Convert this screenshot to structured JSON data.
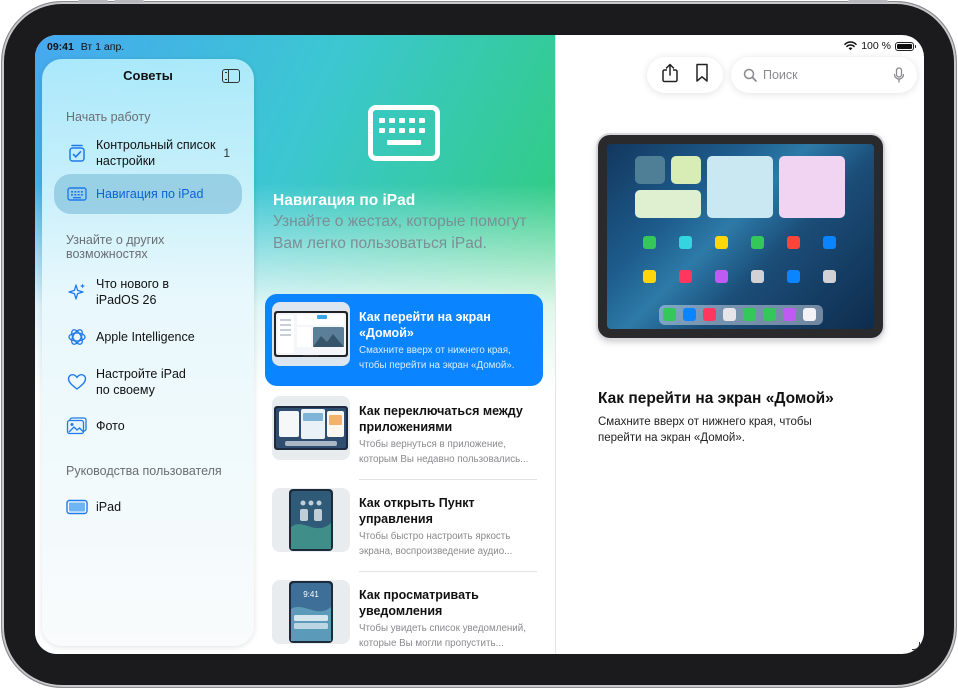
{
  "status_bar": {
    "time": "09:41",
    "date": "Вт 1 апр.",
    "battery_percent": "100 %",
    "battery_level": 1.0
  },
  "sidebar": {
    "title": "Советы",
    "sections": [
      {
        "header": "Начать работу"
      },
      {
        "header": "Узнайте о других возможностях"
      },
      {
        "header": "Руководства пользователя"
      }
    ],
    "items": [
      {
        "label": "Контрольный список настройки",
        "count": "1",
        "icon": "checklist-icon"
      },
      {
        "label": "Навигация по iPad",
        "icon": "keyboard-icon",
        "selected": true
      },
      {
        "label": "Что нового в iPadOS 26",
        "icon": "sparkles-icon"
      },
      {
        "label": "Apple Intelligence",
        "icon": "apple-intelligence-icon"
      },
      {
        "label": "Настройте iPad по своему",
        "icon": "heart-icon"
      },
      {
        "label": "Фото",
        "icon": "photos-icon"
      },
      {
        "label": "iPad",
        "icon": "ipad-icon"
      }
    ]
  },
  "collection": {
    "title": "Навигация по iPad",
    "subtitle": "Узнайте о жестах, которые помогут Вам легко пользоваться iPad.",
    "icon": "keyboard-icon",
    "tips": [
      {
        "title": "Как перейти на экран «Домой»",
        "desc1": "Смахните вверх от нижнего края,",
        "desc2": "чтобы перейти на экран «Домой».",
        "selected": true
      },
      {
        "title": "Как переключаться между приложениями",
        "desc1": "Чтобы вернуться в приложение,",
        "desc2": "которым Вы недавно пользовались..."
      },
      {
        "title": "Как открыть Пункт управления",
        "desc1": "Чтобы быстро настроить яркость",
        "desc2": "экрана, воспроизведение аудио..."
      },
      {
        "title": "Как просматривать уведомления",
        "desc1": "Чтобы увидеть список уведомлений,",
        "desc2": "которые Вы могли пропустить..."
      }
    ]
  },
  "detail": {
    "toolbar": {
      "share_icon": "share-icon",
      "bookmark_icon": "bookmark-icon"
    },
    "search": {
      "placeholder": "Поиск"
    },
    "thumb_time": "9:41",
    "title": "Как перейти на экран «Домой»",
    "description": "Смахните вверх от нижнего края, чтобы перейти на экран «Домой»."
  },
  "colors": {
    "accent": "#0A84FF",
    "selection": "#86C4DE"
  }
}
